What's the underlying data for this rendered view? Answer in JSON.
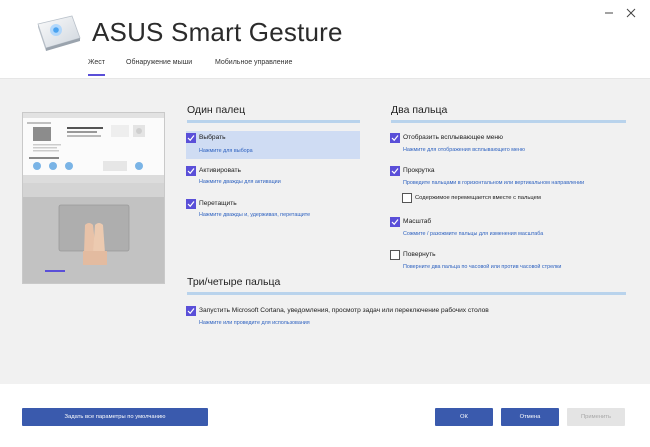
{
  "app": {
    "title": "ASUS Smart Gesture",
    "logo_icon": "smart-gesture-touchpad-logo"
  },
  "tabs": [
    {
      "label": "Жест",
      "active": true
    },
    {
      "label": "Обнаружение мыши",
      "active": false
    },
    {
      "label": "Мобильное управление",
      "active": false
    }
  ],
  "sections": {
    "one_finger": {
      "title": "Один палец",
      "options": [
        {
          "label": "Выбрать",
          "desc": "Нажмите для выбора",
          "checked": true
        },
        {
          "label": "Активировать",
          "desc": "Нажмите дважды для активации",
          "checked": true
        },
        {
          "label": "Перетащить",
          "desc": "Нажмите дважды и, удерживая, перетащите",
          "checked": true
        }
      ]
    },
    "two_fingers": {
      "title": "Два пальца",
      "options": [
        {
          "label": "Отобразить всплывающее меню",
          "desc": "Нажмите для отображения всплывающего меню",
          "checked": true
        },
        {
          "label": "Прокрутка",
          "desc": "Проведите пальцами в горизонтальном или вертикальном направлении",
          "checked": true
        },
        {
          "label": "Содержимое перемещается вместе с пальцем",
          "checked": false
        },
        {
          "label": "Масштаб",
          "desc": "Сожмите / разожмите пальцы для изменения масштаба",
          "checked": true
        },
        {
          "label": "Повернуть",
          "desc": "Поверните два пальца по часовой или против часовой стрелки",
          "checked": false
        }
      ]
    },
    "three_four": {
      "title": "Три/четыре пальца",
      "options": [
        {
          "label": "Запустить Microsoft Cortana, уведомления, просмотр задач или переключение рабочих столов",
          "desc": "Нажмите или проведите для использования",
          "checked": true
        }
      ]
    }
  },
  "footer": {
    "defaults_label": "Задать все параметры по умолчанию",
    "ok_label": "ОК",
    "cancel_label": "Отмена",
    "apply_label": "Применить"
  },
  "colors": {
    "accent": "#5a4fd8",
    "button_blue": "#3a5aad",
    "link_blue": "#2e62c0",
    "section_bar": "#b9d3ec",
    "highlight": "#cfdcf3"
  }
}
